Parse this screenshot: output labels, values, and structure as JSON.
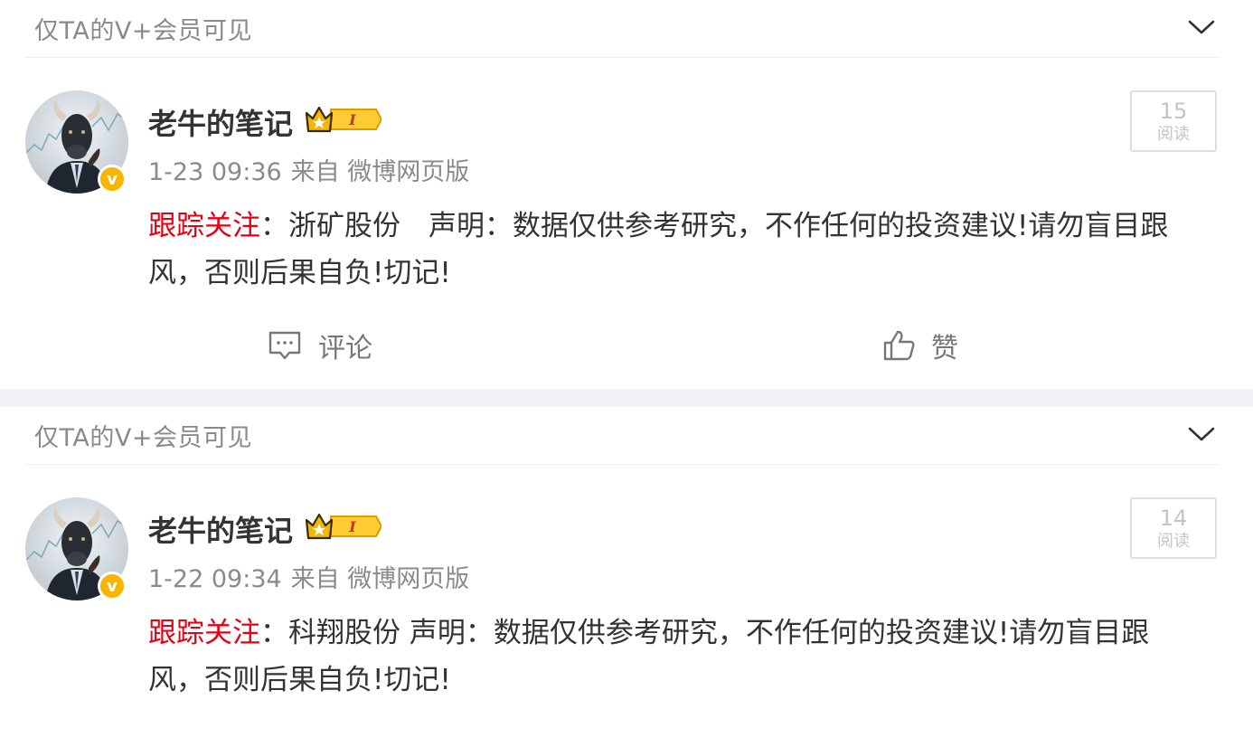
{
  "colors": {
    "tag": "#e60012",
    "meta": "#8a8a8a",
    "text": "#333333",
    "badge": "#f7b500"
  },
  "posts": [
    {
      "visibility": "仅TA的V+会员可见",
      "author": "老牛的笔记",
      "time": "1-23 09:36",
      "source": "来自 微博网页版",
      "reads_count": "15",
      "reads_label": "阅读",
      "tag": "跟踪关注",
      "content": "：浙矿股份　声明：数据仅供参考研究，不作任何的投资建议!请勿盲目跟风，否则后果自负!切记!",
      "comment_label": "评论",
      "like_label": "赞"
    },
    {
      "visibility": "仅TA的V+会员可见",
      "author": "老牛的笔记",
      "time": "1-22 09:34",
      "source": "来自 微博网页版",
      "reads_count": "14",
      "reads_label": "阅读",
      "tag": "跟踪关注",
      "content": "：科翔股份  声明：数据仅供参考研究，不作任何的投资建议!请勿盲目跟风，否则后果自负!切记!"
    }
  ],
  "icons": {
    "collapse": "chevron-down-icon",
    "verified": "verified-v-badge",
    "member": "crown-member-badge",
    "comment": "comment-icon",
    "like": "thumbs-up-icon"
  }
}
